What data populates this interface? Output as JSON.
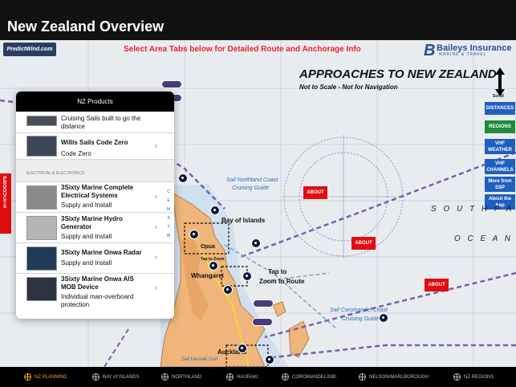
{
  "title": "New Zealand Overview",
  "banner": "Select Area Tabs below for Detailed Route and Anchorage Info",
  "logos": {
    "predictwind": "PredictWind.com",
    "baileys": "Baileys Insurance",
    "baileys_tagline": "MARINE & TRAVEL"
  },
  "chart": {
    "title": "APPROACHES TO NEW ZEALAND",
    "subtitle": "Not to Scale - Not for Navigation",
    "scroll_label": "Scroll"
  },
  "side_buttons": [
    {
      "label": "DISTANCES",
      "color": "#1f5fbf"
    },
    {
      "label": "REGIONS",
      "color": "#1f8a3c"
    },
    {
      "label": "VHF WEATHER",
      "color": "#1f5fbf"
    },
    {
      "label": "VHF CHANNELS",
      "color": "#1f5fbf"
    },
    {
      "label": "More from SSP",
      "color": "#1f5fbf"
    },
    {
      "label": "About the App",
      "color": "#1f5fbf"
    }
  ],
  "about_label": "ABOUT",
  "map_labels": {
    "bay_of_islands": "Bay of Islands",
    "opua": "Opua",
    "whangarei": "Whangarei",
    "tap_to_zoom": "Tap to Zoom",
    "tap_to_zoom_route_1": "Tap to",
    "tap_to_zoom_route_2": "Zoom to Route",
    "auckland": "Auckland",
    "northland_guide_1": "Sail Northland Coast",
    "northland_guide_2": "Cruising Guide",
    "coromandel_guide_1": "Sail Coromandel Coast",
    "coromandel_guide_2": "Cruising Guide",
    "hauraki": "Sail Hauraki Gulf",
    "south": "S O U T H   P A",
    "ocean": "O C E A N"
  },
  "products_tab_label": "PRODUCTS",
  "popover": {
    "header": "NZ Products",
    "items_top": [
      {
        "title": "Cruising Sails built to go the distance",
        "subtitle": ""
      },
      {
        "title": "Willis Sails Code Zero",
        "subtitle": "Code Zero"
      }
    ],
    "section_header": "ELECTRICAL & ELECTRONICS",
    "items": [
      {
        "title": "3Sixty Marine Complete Electrical Systems",
        "subtitle": "Supply and Install"
      },
      {
        "title": "3Sixty Marine Hydro Generator",
        "subtitle": "Supply and Install"
      },
      {
        "title": "3Sixty Marine Onwa Radar",
        "subtitle": "Supply and Install"
      },
      {
        "title": "3Sixty Marine Onwa AIS MOB Device",
        "subtitle": "Individual man-overboard protection"
      }
    ],
    "index_letters": [
      "C",
      "E",
      "M",
      "S",
      "T",
      "W"
    ]
  },
  "tabs": [
    {
      "label": "NZ PLANNING",
      "active": true
    },
    {
      "label": "BAY of ISLANDS",
      "active": false
    },
    {
      "label": "NORTHLAND",
      "active": false
    },
    {
      "label": "HAURAKI",
      "active": false
    },
    {
      "label": "COROMANDEL/GBI",
      "active": false
    },
    {
      "label": "NELSON/MARLBOROUGH",
      "active": false
    },
    {
      "label": "NZ REGIONS",
      "active": false
    }
  ]
}
